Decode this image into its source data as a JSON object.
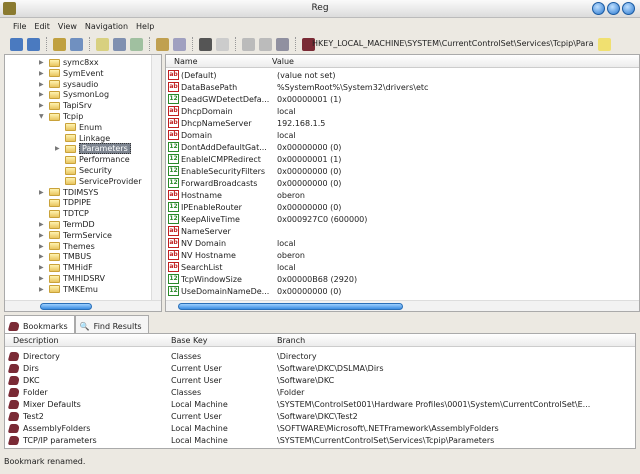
{
  "window": {
    "title": "Reg"
  },
  "menu": [
    "File",
    "Edit",
    "View",
    "Navigation",
    "Help"
  ],
  "address": "HKEY_LOCAL_MACHINE\\SYSTEM\\CurrentControlSet\\Services\\Tcpip\\Para",
  "tree": [
    {
      "label": "symc8xx",
      "level": 0,
      "expander": "collapsed"
    },
    {
      "label": "SymEvent",
      "level": 0,
      "expander": "collapsed"
    },
    {
      "label": "sysaudio",
      "level": 0,
      "expander": "collapsed"
    },
    {
      "label": "SysmonLog",
      "level": 0,
      "expander": "collapsed"
    },
    {
      "label": "TapiSrv",
      "level": 0,
      "expander": "collapsed"
    },
    {
      "label": "Tcpip",
      "level": 0,
      "expander": "expanded"
    },
    {
      "label": "Enum",
      "level": 1,
      "expander": "none"
    },
    {
      "label": "Linkage",
      "level": 1,
      "expander": "none"
    },
    {
      "label": "Parameters",
      "level": 1,
      "expander": "collapsed",
      "selected": true
    },
    {
      "label": "Performance",
      "level": 1,
      "expander": "none"
    },
    {
      "label": "Security",
      "level": 1,
      "expander": "none"
    },
    {
      "label": "ServiceProvider",
      "level": 1,
      "expander": "none"
    },
    {
      "label": "TDIMSYS",
      "level": 0,
      "expander": "collapsed"
    },
    {
      "label": "TDPIPE",
      "level": 0,
      "expander": "none"
    },
    {
      "label": "TDTCP",
      "level": 0,
      "expander": "none"
    },
    {
      "label": "TermDD",
      "level": 0,
      "expander": "collapsed"
    },
    {
      "label": "TermService",
      "level": 0,
      "expander": "collapsed"
    },
    {
      "label": "Themes",
      "level": 0,
      "expander": "collapsed"
    },
    {
      "label": "TMBUS",
      "level": 0,
      "expander": "collapsed"
    },
    {
      "label": "TMHidF",
      "level": 0,
      "expander": "collapsed"
    },
    {
      "label": "TMHIDSRV",
      "level": 0,
      "expander": "collapsed"
    },
    {
      "label": "TMKEmu",
      "level": 0,
      "expander": "collapsed"
    }
  ],
  "values": {
    "headers": [
      "Name",
      "Value"
    ],
    "rows": [
      {
        "type": "ab",
        "name": "(Default)",
        "value": "(value not set)"
      },
      {
        "type": "ab",
        "name": "DataBasePath",
        "value": "%SystemRoot%\\System32\\drivers\\etc"
      },
      {
        "type": "num",
        "name": "DeadGWDetectDefa...",
        "value": "0x00000001  (1)"
      },
      {
        "type": "ab",
        "name": "DhcpDomain",
        "value": "local"
      },
      {
        "type": "ab",
        "name": "DhcpNameServer",
        "value": "192.168.1.5"
      },
      {
        "type": "ab",
        "name": "Domain",
        "value": "local"
      },
      {
        "type": "num",
        "name": "DontAddDefaultGat...",
        "value": "0x00000000  (0)"
      },
      {
        "type": "num",
        "name": "EnableICMPRedirect",
        "value": "0x00000001  (1)"
      },
      {
        "type": "num",
        "name": "EnableSecurityFilters",
        "value": "0x00000000  (0)"
      },
      {
        "type": "num",
        "name": "ForwardBroadcasts",
        "value": "0x00000000  (0)"
      },
      {
        "type": "ab",
        "name": "Hostname",
        "value": "oberon"
      },
      {
        "type": "num",
        "name": "IPEnableRouter",
        "value": "0x00000000  (0)"
      },
      {
        "type": "num",
        "name": "KeepAliveTime",
        "value": "0x000927C0  (600000)"
      },
      {
        "type": "ab",
        "name": "NameServer",
        "value": ""
      },
      {
        "type": "ab",
        "name": "NV Domain",
        "value": "local"
      },
      {
        "type": "ab",
        "name": "NV Hostname",
        "value": "oberon"
      },
      {
        "type": "ab",
        "name": "SearchList",
        "value": "local"
      },
      {
        "type": "num",
        "name": "TcpWindowSize",
        "value": "0x00000B68  (2920)"
      },
      {
        "type": "num",
        "name": "UseDomainNameDe...",
        "value": "0x00000000  (0)"
      }
    ]
  },
  "tabs": [
    "Bookmarks",
    "Find Results"
  ],
  "bookmarks": {
    "headers": [
      "Description",
      "Base Key",
      "Branch"
    ],
    "rows": [
      [
        "Directory",
        "Classes",
        "\\Directory"
      ],
      [
        "Dirs",
        "Current User",
        "\\Software\\DKC\\DSLMA\\Dirs"
      ],
      [
        "DKC",
        "Current User",
        "\\Software\\DKC"
      ],
      [
        "Folder",
        "Classes",
        "\\Folder"
      ],
      [
        "Mixer Defaults",
        "Local Machine",
        "\\SYSTEM\\ControlSet001\\Hardware Profiles\\0001\\System\\CurrentControlSet\\E..."
      ],
      [
        "Test2",
        "Current User",
        "\\Software\\DKC\\Test2"
      ],
      [
        "AssemblyFolders",
        "Local Machine",
        "\\SOFTWARE\\Microsoft\\.NETFramework\\AssemblyFolders"
      ],
      [
        "TCP/IP parameters",
        "Local Machine",
        "\\SYSTEM\\CurrentControlSet\\Services\\Tcpip\\Parameters"
      ]
    ]
  },
  "status": "Bookmark renamed."
}
